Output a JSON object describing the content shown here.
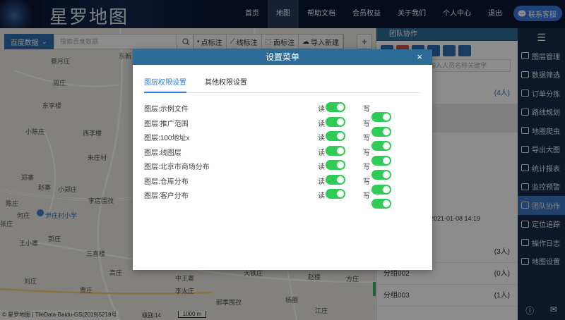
{
  "header": {
    "logo_text": "星罗地图",
    "nav": [
      "首页",
      "地图",
      "帮助文档",
      "会员权益",
      "关于我们",
      "个人中心",
      "退出"
    ],
    "nav_active_index": 1,
    "contact_label": "联系客服"
  },
  "map": {
    "source_label": "百度数据",
    "search_placeholder": "搜索百度数据",
    "tools": [
      "点标注",
      "线标注",
      "面标注",
      "导入新建"
    ],
    "add_label": "+",
    "place_labels": [
      "东新",
      "蔡月庄",
      "周庄",
      "东李楼",
      "小陈庄",
      "西李楼",
      "朱庄村",
      "郑寨",
      "赵寨",
      "小郑庄",
      "李店围孜",
      "陈庄",
      "何庄",
      "尹庄村小学",
      "张庄",
      "郭庄",
      "王小寨",
      "三喜楼",
      "高庄",
      "刘庄",
      "贾庄",
      "中王寨",
      "李太庄",
      "赵楼",
      "方庄",
      "郝季围孜",
      "杨圈",
      "江庄",
      "大铁庄"
    ],
    "copyright": "© 星罗地图 | TileData-Baidu-GS(2019)5218号",
    "level_label": "级别:14",
    "scale_label": "1000 m"
  },
  "team_panel": {
    "title": "团队协作",
    "search_placeholder": "输入人员名称关键字",
    "top_count": "(4人)",
    "date_text": "2021-01-08 14:19",
    "groups": [
      {
        "name": "",
        "count": "(3人)"
      },
      {
        "name": "分组002",
        "count": "(0人)"
      },
      {
        "name": "分组003",
        "count": "(1人)"
      }
    ]
  },
  "sidebar": {
    "items": [
      "图层管理",
      "数据筛选",
      "订单分拣",
      "路线规划",
      "地图爬虫",
      "导出大图",
      "统计报表",
      "监控预警",
      "团队协作",
      "定位追踪",
      "操作日志",
      "地图设置"
    ],
    "active_index": 8
  },
  "modal": {
    "title": "设置菜单",
    "close": "×",
    "tabs": [
      "图层权限设置",
      "其他权限设置"
    ],
    "active_tab": 0,
    "read_label": "读",
    "write_label": "写",
    "permissions": [
      {
        "layer": "图层:示例文件",
        "read": true,
        "write": true
      },
      {
        "layer": "图层:推广范围",
        "read": true,
        "write": true
      },
      {
        "layer": "图层:100地址x",
        "read": true,
        "write": true
      },
      {
        "layer": "图层:线图层",
        "read": true,
        "write": true
      },
      {
        "layer": "图层:北京市商场分布",
        "read": true,
        "write": true
      },
      {
        "layer": "图层:仓库分布",
        "read": true,
        "write": true
      },
      {
        "layer": "图层:客户分布",
        "read": true,
        "write": true
      }
    ]
  }
}
